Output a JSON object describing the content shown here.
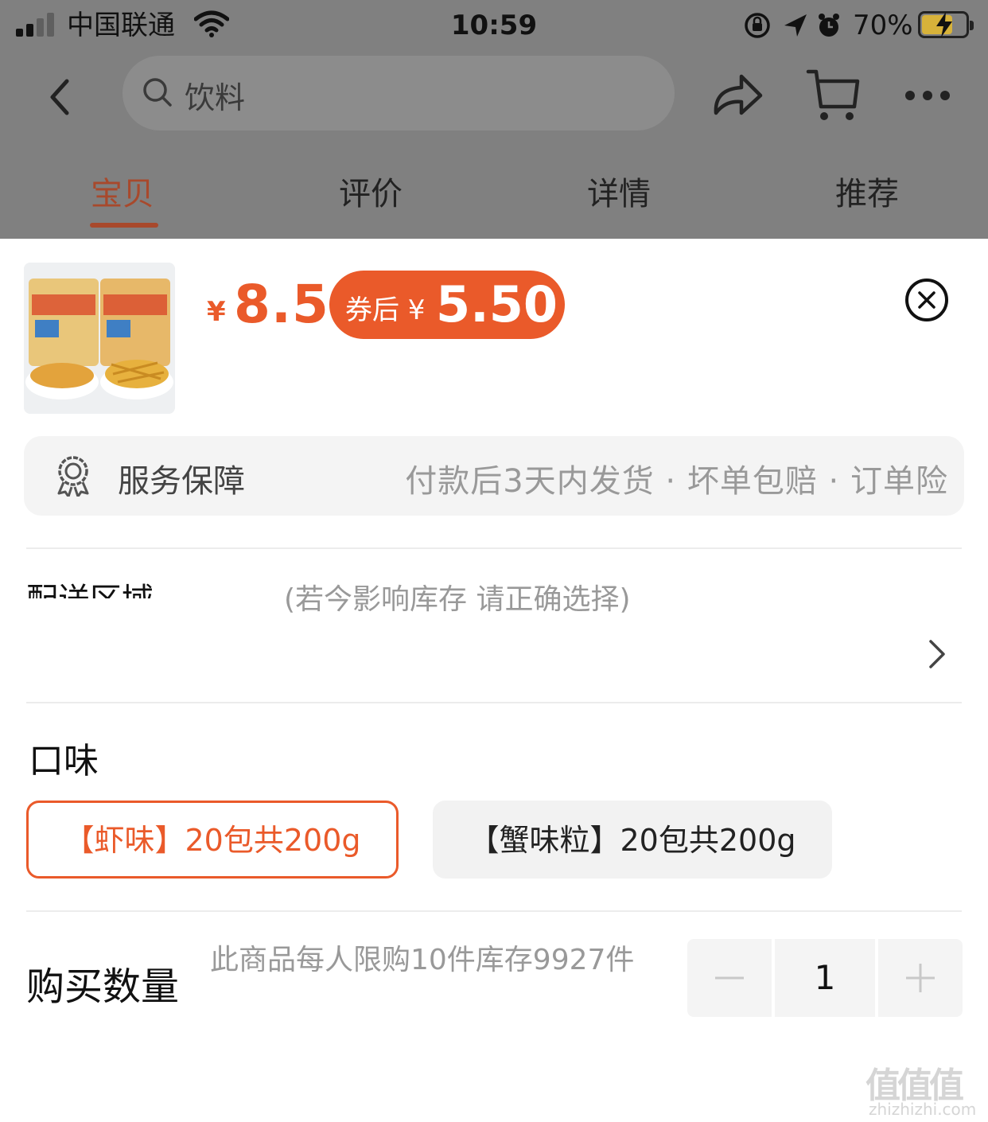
{
  "status_bar": {
    "carrier": "中国联通",
    "time": "10:59",
    "battery_percent": "70%",
    "battery_level": 0.7
  },
  "nav": {
    "search_text": "饮料"
  },
  "tabs": [
    {
      "label": "宝贝",
      "active": true
    },
    {
      "label": "评价",
      "active": false
    },
    {
      "label": "详情",
      "active": false
    },
    {
      "label": "推荐",
      "active": false
    }
  ],
  "product": {
    "currency": "¥",
    "price": "8.5",
    "coupon_label": "券后 ¥",
    "coupon_price": "5.50"
  },
  "service": {
    "title": "服务保障",
    "desc": "付款后3天内发货 · 坏单包赔 · 订单险"
  },
  "delivery": {
    "label": "配送区域",
    "hint": "(若今影响库存 请正确选择)"
  },
  "flavor": {
    "title": "口味",
    "options": [
      {
        "label": "【虾味】20包共200g",
        "selected": true
      },
      {
        "label": "【蟹味粒】20包共200g",
        "selected": false
      }
    ]
  },
  "quantity": {
    "title": "购买数量",
    "note": "此商品每人限购10件库存9927件",
    "value": "1"
  },
  "watermark": {
    "mark": "值值值",
    "site": "zhizhizhi.com"
  },
  "colors": {
    "accent": "#ea5a2a",
    "tab_active": "#a8492c"
  }
}
